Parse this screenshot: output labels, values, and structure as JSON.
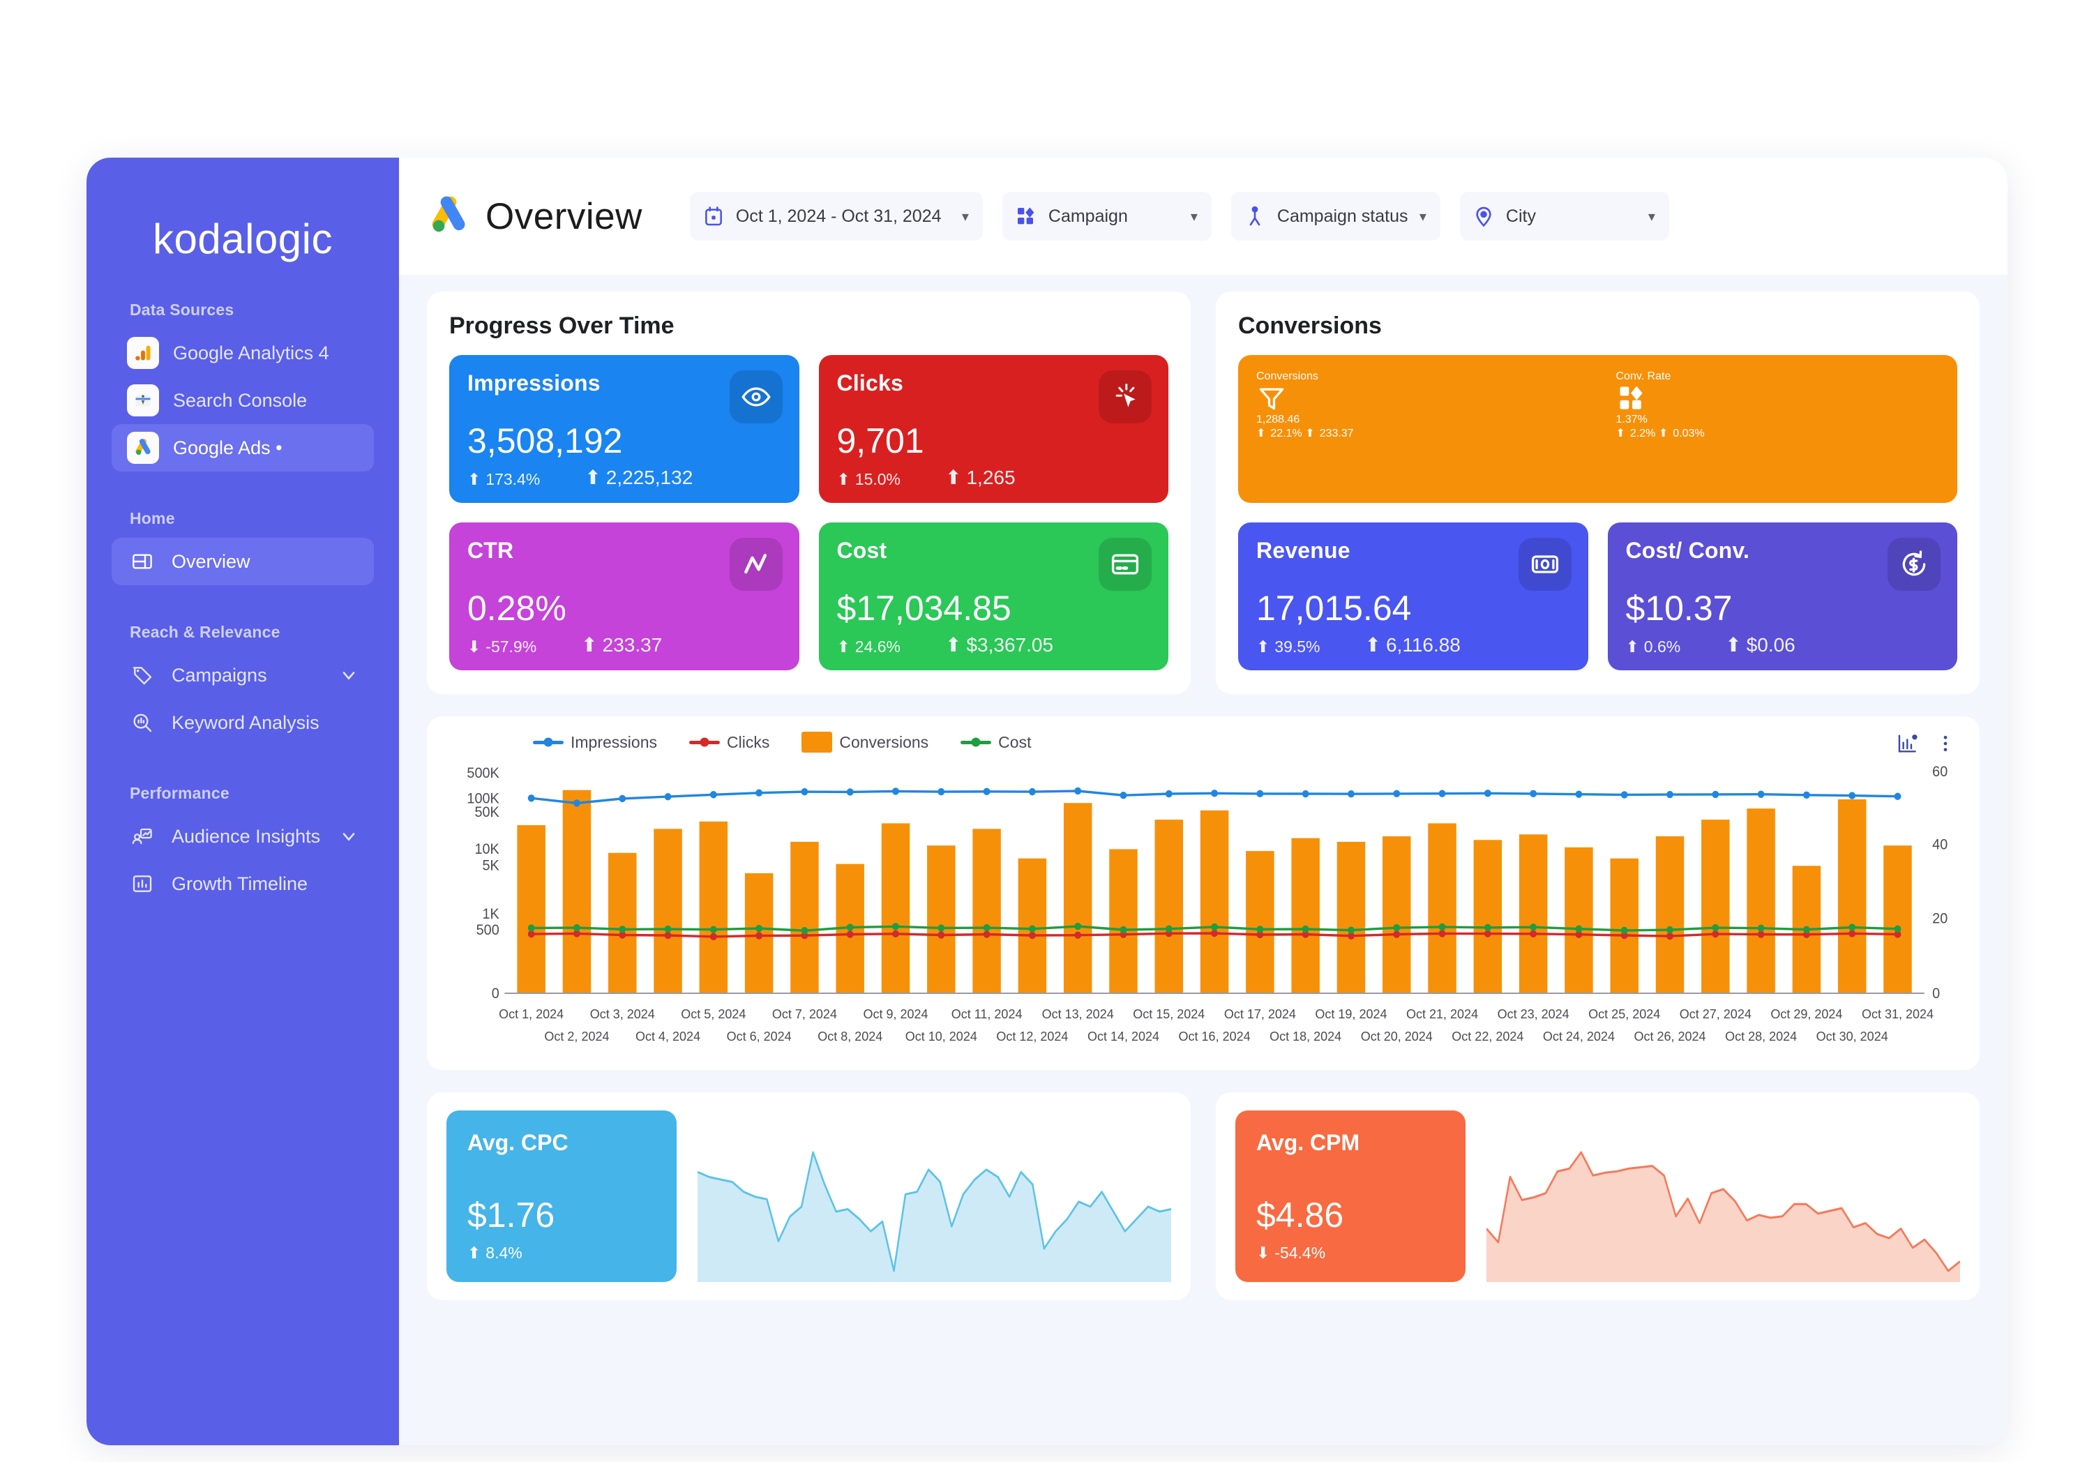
{
  "brand": "kodalogic",
  "sidebar": {
    "sections": [
      {
        "title": "Data Sources",
        "items": [
          {
            "label": "Google Analytics 4",
            "icon": "google-analytics-icon",
            "active": false
          },
          {
            "label": "Search Console",
            "icon": "search-console-icon",
            "active": false
          },
          {
            "label": "Google Ads •",
            "icon": "google-ads-icon",
            "active": true
          }
        ]
      },
      {
        "title": "Home",
        "items": [
          {
            "label": "Overview",
            "icon": "layout-dashboard-icon",
            "active": true
          }
        ]
      },
      {
        "title": "Reach & Relevance",
        "items": [
          {
            "label": "Campaigns",
            "icon": "tag-icon",
            "active": false,
            "chevron": true
          },
          {
            "label": "Keyword Analysis",
            "icon": "search-chart-icon",
            "active": false
          }
        ]
      },
      {
        "title": "Performance",
        "items": [
          {
            "label": "Audience Insights",
            "icon": "audience-icon",
            "active": false,
            "chevron": true
          },
          {
            "label": "Growth Timeline",
            "icon": "bar-chart-icon",
            "active": false
          }
        ]
      }
    ]
  },
  "header": {
    "title": "Overview",
    "logo_icon": "google-ads-logo-icon",
    "filters": [
      {
        "name": "date-range",
        "icon": "calendar-icon",
        "value": "Oct 1, 2024 - Oct 31, 2024"
      },
      {
        "name": "campaign",
        "icon": "campaign-icon",
        "value": "Campaign"
      },
      {
        "name": "campaign-status",
        "icon": "status-icon",
        "value": "Campaign status"
      },
      {
        "name": "city",
        "icon": "location-pin-icon",
        "value": "City"
      }
    ]
  },
  "progress_panel": {
    "title": "Progress Over Time",
    "cards": [
      {
        "label": "Impressions",
        "value": "3,508,192",
        "delta_pct": "173.4%",
        "delta_pct_dir": "up",
        "delta_abs": "2,225,132",
        "delta_abs_dir": "up",
        "icon": "eye-icon",
        "color": "#1a84f0"
      },
      {
        "label": "Clicks",
        "value": "9,701",
        "delta_pct": "15.0%",
        "delta_pct_dir": "up",
        "delta_abs": "1,265",
        "delta_abs_dir": "up",
        "icon": "click-cursor-icon",
        "color": "#d92020"
      },
      {
        "label": "CTR",
        "value": "0.28%",
        "delta_pct": "-57.9%",
        "delta_pct_dir": "down",
        "delta_abs": "233.37",
        "delta_abs_dir": "up",
        "icon": "trend-line-icon",
        "color": "#c543d9"
      },
      {
        "label": "Cost",
        "value": "$17,034.85",
        "delta_pct": "24.6%",
        "delta_pct_dir": "up",
        "delta_abs": "$3,367.05",
        "delta_abs_dir": "up",
        "icon": "credit-card-icon",
        "color": "#2bc757"
      }
    ]
  },
  "conversions_panel": {
    "title": "Conversions",
    "wide": [
      {
        "label": "Conversions",
        "value": "1,288.46",
        "delta_pct": "22.1%",
        "delta_pct_dir": "up",
        "delta_abs": "233.37",
        "delta_abs_dir": "up",
        "icon": "funnel-icon"
      },
      {
        "label": "Conv. Rate",
        "value": "1.37%",
        "delta_pct": "2.2%",
        "delta_pct_dir": "up",
        "delta_abs": "0.03%",
        "delta_abs_dir": "up",
        "icon": "blocks-icon"
      }
    ],
    "wide_color": "#f79009",
    "cards": [
      {
        "label": "Revenue",
        "value": "17,015.64",
        "delta_pct": "39.5%",
        "delta_pct_dir": "up",
        "delta_abs": "6,116.88",
        "delta_abs_dir": "up",
        "icon": "money-icon",
        "color": "#4a56f0"
      },
      {
        "label": "Cost/ Conv.",
        "value": "$10.37",
        "delta_pct": "0.6%",
        "delta_pct_dir": "up",
        "delta_abs": "$0.06",
        "delta_abs_dir": "up",
        "icon": "refund-icon",
        "color": "#5b4fd6"
      }
    ]
  },
  "chart_data": {
    "type": "bar",
    "title": "",
    "xlabel": "",
    "ylabel": "",
    "grid": false,
    "legend_position": "top-left",
    "y_left_ticks": [
      "0",
      "500",
      "1K",
      "5K",
      "10K",
      "50K",
      "100K",
      "500K"
    ],
    "y_left_scale": "log",
    "y_right_ticks": [
      "0",
      "20",
      "40",
      "60"
    ],
    "y_right_range": [
      0,
      60
    ],
    "categories": [
      "Oct 1, 2024",
      "Oct 2, 2024",
      "Oct 3, 2024",
      "Oct 4, 2024",
      "Oct 5, 2024",
      "Oct 6, 2024",
      "Oct 7, 2024",
      "Oct 8, 2024",
      "Oct 9, 2024",
      "Oct 10, 2024",
      "Oct 11, 2024",
      "Oct 12, 2024",
      "Oct 13, 2024",
      "Oct 14, 2024",
      "Oct 15, 2024",
      "Oct 16, 2024",
      "Oct 17, 2024",
      "Oct 18, 2024",
      "Oct 19, 2024",
      "Oct 20, 2024",
      "Oct 21, 2024",
      "Oct 22, 2024",
      "Oct 23, 2024",
      "Oct 24, 2024",
      "Oct 25, 2024",
      "Oct 26, 2024",
      "Oct 27, 2024",
      "Oct 28, 2024",
      "Oct 29, 2024",
      "Oct 30, 2024",
      "Oct 31, 2024"
    ],
    "series": [
      {
        "name": "Conversions",
        "type": "bar",
        "axis": "right",
        "color": "#f79009",
        "values": [
          45.5,
          55.0,
          38.0,
          44.5,
          46.5,
          32.5,
          41.0,
          35.0,
          46.0,
          40.0,
          44.5,
          36.5,
          51.5,
          39.0,
          47.0,
          49.5,
          38.5,
          42.0,
          41.0,
          42.5,
          46.0,
          41.5,
          43.0,
          39.5,
          36.5,
          42.5,
          47.0,
          50.0,
          34.5,
          52.5,
          40.0
        ]
      },
      {
        "name": "Impressions",
        "type": "line",
        "axis": "left",
        "color": "#2086e0",
        "values": [
          100000,
          78000,
          98000,
          110000,
          125000,
          140000,
          150000,
          148000,
          155000,
          150000,
          152000,
          150000,
          158000,
          120000,
          132000,
          136000,
          133000,
          132000,
          131000,
          133000,
          134000,
          136000,
          133000,
          128000,
          124000,
          126000,
          127000,
          128000,
          122000,
          118000,
          112000
        ]
      },
      {
        "name": "Clicks",
        "type": "line",
        "axis": "left",
        "color": "#d42a2a",
        "values": [
          330,
          345,
          300,
          290,
          255,
          280,
          285,
          320,
          335,
          300,
          320,
          290,
          295,
          315,
          350,
          355,
          310,
          320,
          275,
          320,
          345,
          340,
          335,
          315,
          290,
          268,
          330,
          318,
          315,
          345,
          322
        ]
      },
      {
        "name": "Cost",
        "type": "line",
        "axis": "left",
        "color": "#1f9d40",
        "values": [
          540,
          545,
          510,
          515,
          505,
          530,
          460,
          555,
          575,
          540,
          545,
          520,
          580,
          500,
          520,
          565,
          510,
          515,
          480,
          545,
          565,
          550,
          560,
          520,
          470,
          495,
          545,
          535,
          505,
          555,
          520
        ]
      }
    ],
    "tools": [
      "chart-settings-icon",
      "more-options-icon"
    ]
  },
  "bottom_cards": [
    {
      "label": "Avg. CPC",
      "value": "$1.76",
      "delta": "8.4%",
      "delta_dir": "up",
      "color": "#45b4e8",
      "fill": "#cfeaf7",
      "stroke": "#5cc3e8",
      "spark": [
        52,
        50,
        49,
        48,
        44,
        42,
        41,
        24,
        34,
        38,
        60,
        47,
        36,
        37,
        33,
        28,
        32,
        12,
        43,
        44,
        53,
        48,
        30,
        43,
        49,
        53,
        50,
        42,
        52,
        47,
        21,
        28,
        33,
        40,
        38,
        44,
        36,
        28,
        33,
        38,
        36,
        37
      ]
    },
    {
      "label": "Avg. CPM",
      "value": "$4.86",
      "delta": "-54.4%",
      "delta_dir": "down",
      "color": "#f86a41",
      "fill": "#fbd4c8",
      "stroke": "#f4795a",
      "spark": [
        34,
        24,
        72,
        55,
        57,
        60,
        76,
        78,
        90,
        73,
        75,
        76,
        78,
        79,
        80,
        73,
        43,
        56,
        38,
        60,
        63,
        54,
        40,
        44,
        42,
        43,
        52,
        52,
        45,
        47,
        49,
        35,
        38,
        30,
        27,
        34,
        20,
        26,
        16,
        3,
        10
      ]
    }
  ]
}
